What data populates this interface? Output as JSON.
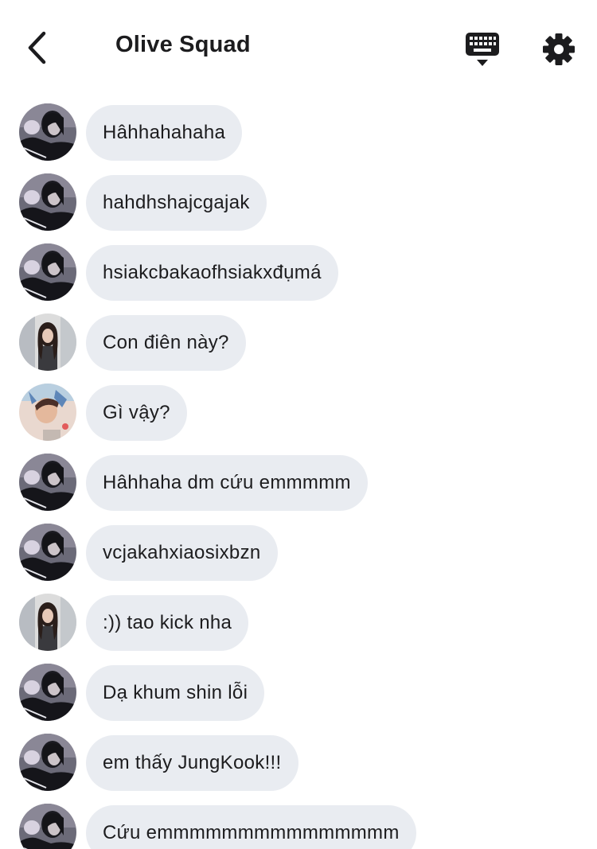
{
  "header": {
    "title": "Olive Squad",
    "back_icon": "chevron-left-icon",
    "keyboard_icon": "keyboard-icon",
    "settings_icon": "gear-icon"
  },
  "colors": {
    "bubble_bg": "#e9ecf1",
    "text": "#1c1c1e",
    "background": "#ffffff"
  },
  "messages": [
    {
      "sender": "a",
      "text": "Hâhhahahaha"
    },
    {
      "sender": "a",
      "text": "hahdhshajcgajak"
    },
    {
      "sender": "a",
      "text": "hsiakcbakaofhsiakxđụmá"
    },
    {
      "sender": "b",
      "text": "Con điên này?"
    },
    {
      "sender": "c",
      "text": "Gì vậy?"
    },
    {
      "sender": "a",
      "text": "Hâhhaha dm cứu emmmmm"
    },
    {
      "sender": "a",
      "text": "vcjakahxiaosixbzn"
    },
    {
      "sender": "b",
      "text": ":)) tao kick nha"
    },
    {
      "sender": "a",
      "text": "Dạ khum shin lỗi"
    },
    {
      "sender": "a",
      "text": "em thấy JungKook!!!"
    },
    {
      "sender": "a",
      "text": "Cứu emmmmmmmmmmmmmmm"
    }
  ]
}
